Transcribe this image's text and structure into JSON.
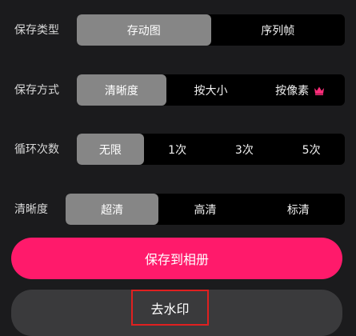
{
  "settings": {
    "save_type": {
      "label": "保存类型",
      "options": [
        "存动图",
        "序列帧"
      ],
      "selected_index": 0
    },
    "save_method": {
      "label": "保存方式",
      "options": [
        "清晰度",
        "按大小",
        "按像素"
      ],
      "selected_index": 0,
      "premium_option_index": 2,
      "premium_icon": "crown-icon"
    },
    "loop_count": {
      "label": "循环次数",
      "options": [
        "无限",
        "1次",
        "3次",
        "5次"
      ],
      "selected_index": 0
    },
    "clarity": {
      "label": "清晰度",
      "options": [
        "超清",
        "高清",
        "标清"
      ],
      "selected_index": 0
    }
  },
  "actions": {
    "save_label": "保存到相册",
    "remove_watermark_label": "去水印"
  },
  "colors": {
    "background": "#1b1b1d",
    "segment_bg": "#000000",
    "segment_selected": "#868686",
    "primary_button": "#ff1a6b",
    "secondary_button": "#3a3a3c",
    "crown": "#ff2d7a",
    "highlight_border": "#e02020"
  }
}
